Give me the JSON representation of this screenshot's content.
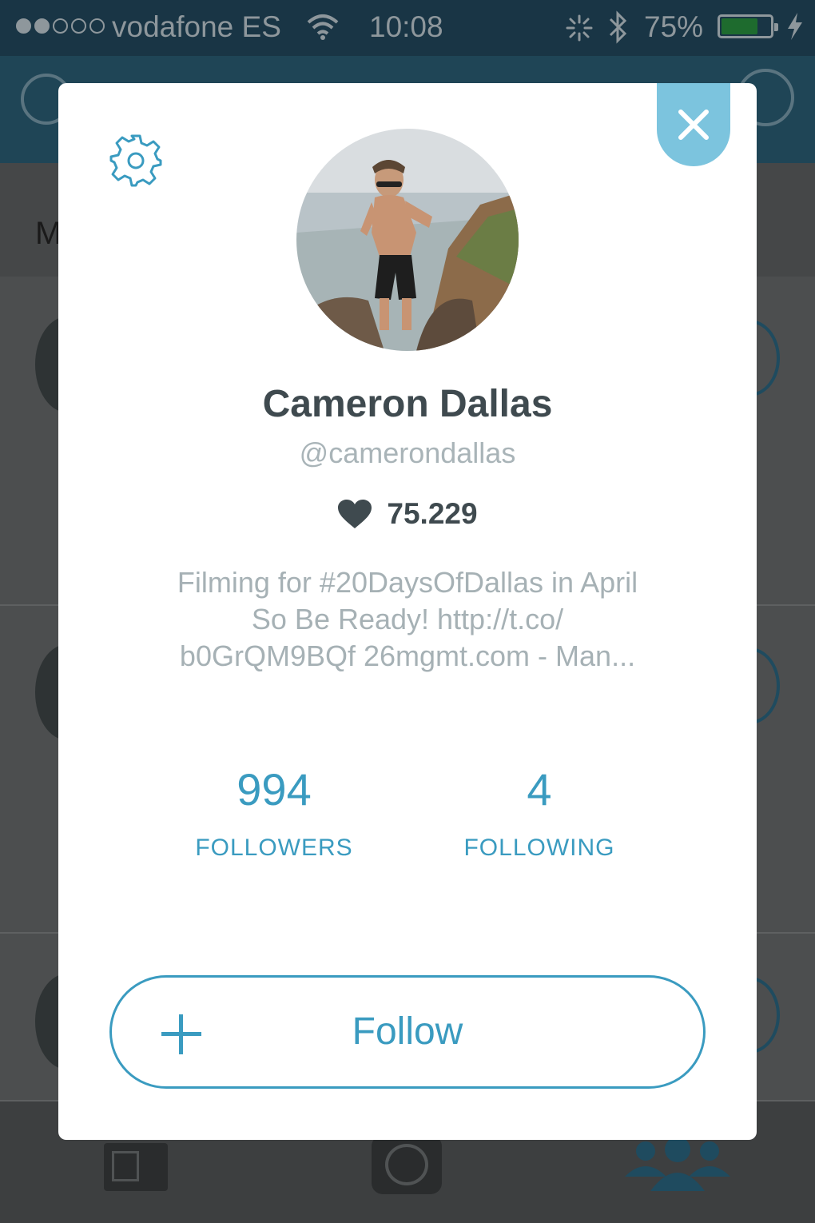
{
  "status_bar": {
    "carrier": "vodafone ES",
    "time": "10:08",
    "battery_text": "75%",
    "battery_level": 0.75,
    "signal_dots_filled": 2,
    "signal_dots_total": 5
  },
  "background": {
    "subheader_letter": "M"
  },
  "profile": {
    "name": "Cameron Dallas",
    "handle": "@camerondallas",
    "likes": "75.229",
    "bio_lines": [
      "Filming for #20DaysOfDallas in April",
      "So Be Ready! http://t.co/",
      "b0GrQM9BQf 26mgmt.com - Man..."
    ],
    "followers_count": "994",
    "followers_label": "FOLLOWERS",
    "following_count": "4",
    "following_label": "FOLLOWING"
  },
  "actions": {
    "follow_label": "Follow"
  },
  "icons": {
    "close": "close-icon",
    "settings": "gear-icon",
    "heart": "heart-icon",
    "plus": "plus-icon"
  },
  "colors": {
    "accent": "#3a9bc0",
    "close_button": "#7cc4de",
    "name_text": "#3f4a4f",
    "muted_text": "#a6b1b5",
    "navbar": "#1f4556",
    "statusbar": "#193545"
  }
}
